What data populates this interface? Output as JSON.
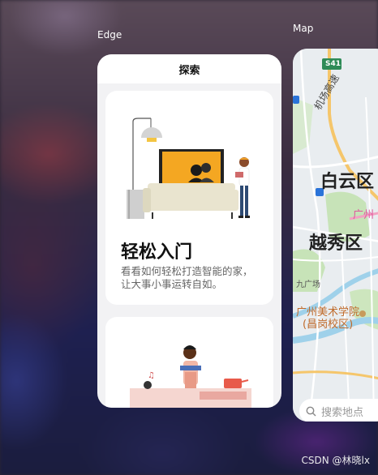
{
  "apps": [
    {
      "label": "Edge",
      "page_title": "探索",
      "promo": {
        "title": "轻松入门",
        "description": "看看如何轻松打造智能的家，让大事小事运转自如。"
      }
    },
    {
      "label": "Map",
      "road_sign": "S41",
      "road_name": "机场高速",
      "districts": [
        "白云区",
        "越秀区"
      ],
      "labels": [
        "广州",
        "九广场",
        "广州美术学院",
        "(昌岗校区)"
      ],
      "search_placeholder": "搜索地点"
    }
  ],
  "watermark": "CSDN @林晓lx"
}
